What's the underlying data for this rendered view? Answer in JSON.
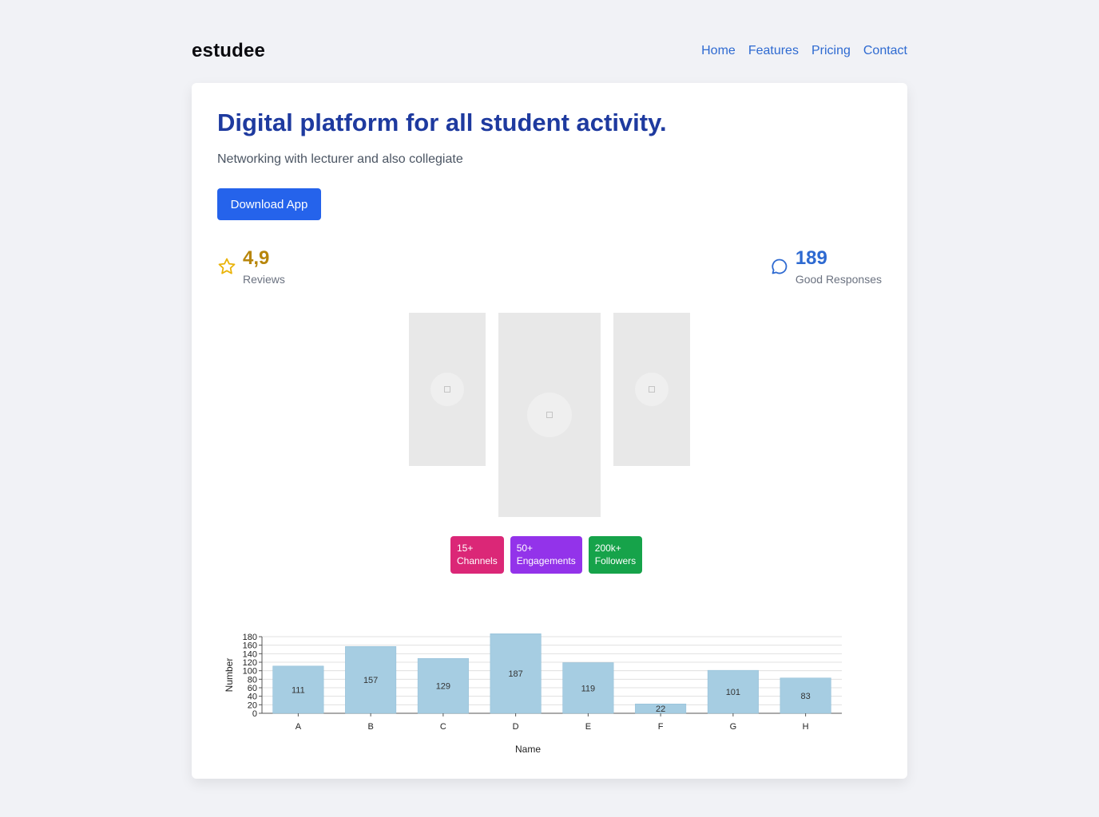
{
  "brand": "estudee",
  "nav": [
    "Home",
    "Features",
    "Pricing",
    "Contact"
  ],
  "hero": {
    "title": "Digital platform for all student activity.",
    "subtitle": "Networking with lecturer and also collegiate",
    "cta": "Download App"
  },
  "stats": {
    "reviews": {
      "value": "4,9",
      "label": "Reviews",
      "icon": "star-icon"
    },
    "responses": {
      "value": "189",
      "label": "Good Responses",
      "icon": "chat-bubble-icon"
    }
  },
  "badges": [
    {
      "count": "15+",
      "label": "Channels",
      "color": "#db2777"
    },
    {
      "count": "50+",
      "label": "Engagements",
      "color": "#9333ea"
    },
    {
      "count": "200k+",
      "label": "Followers",
      "color": "#16a34a"
    }
  ],
  "chart_data": {
    "type": "bar",
    "categories": [
      "A",
      "B",
      "C",
      "D",
      "E",
      "F",
      "G",
      "H"
    ],
    "values": [
      111,
      157,
      129,
      187,
      119,
      22,
      101,
      83
    ],
    "xlabel": "Name",
    "ylabel": "Number",
    "ylim": [
      0,
      180
    ],
    "yticks": [
      0,
      20,
      40,
      60,
      80,
      100,
      120,
      140,
      160,
      180
    ],
    "bar_color": "#a6cde2",
    "grid": true
  }
}
